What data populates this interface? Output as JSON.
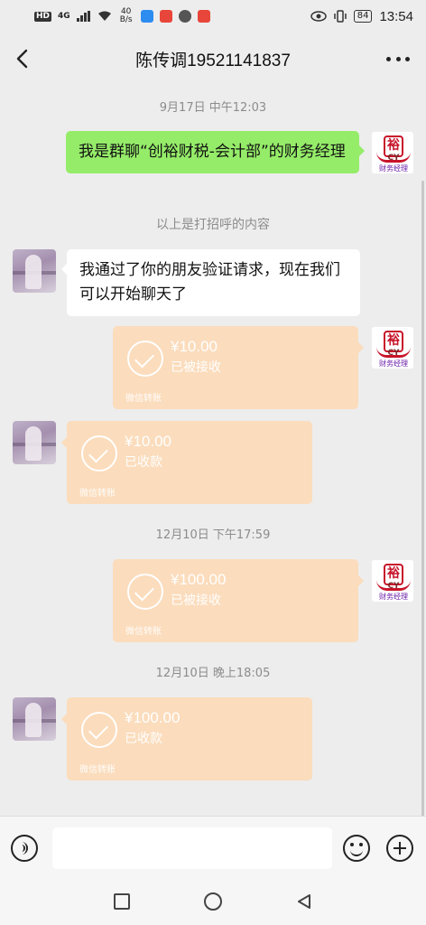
{
  "status_bar": {
    "carrier_badge": "HD",
    "network_type": "4G",
    "speed_value": "40",
    "speed_unit": "B/s",
    "battery_level": "84",
    "time": "13:54"
  },
  "header": {
    "title": "陈传调19521141837"
  },
  "messages": {
    "ts1": "9月17日 中午12:03",
    "greeting_text": "我是群聊“创裕财税-会计部”的财务经理",
    "greeting_note": "以上是打招呼的内容",
    "friend_text": "我通过了你的朋友验证请求，现在我们可以开始聊天了",
    "transfer1": {
      "amount": "¥10.00",
      "status": "已被接收",
      "label": "微信转账"
    },
    "transfer2": {
      "amount": "¥10.00",
      "status": "已收款",
      "label": "微信转账"
    },
    "ts2": "12月10日 下午17:59",
    "transfer3": {
      "amount": "¥100.00",
      "status": "已被接收",
      "label": "微信转账"
    },
    "ts3": "12月10日 晚上18:05",
    "transfer4": {
      "amount": "¥100.00",
      "status": "已收款",
      "label": "微信转账"
    }
  },
  "org_avatar": {
    "mark": "裕",
    "initials": "CY",
    "name": "财务经理"
  },
  "colors": {
    "chat_bg": "#ededed",
    "green_bubble": "#95ec69",
    "transfer_bubble": "#fbdcbc",
    "brand_red": "#c8142a"
  }
}
